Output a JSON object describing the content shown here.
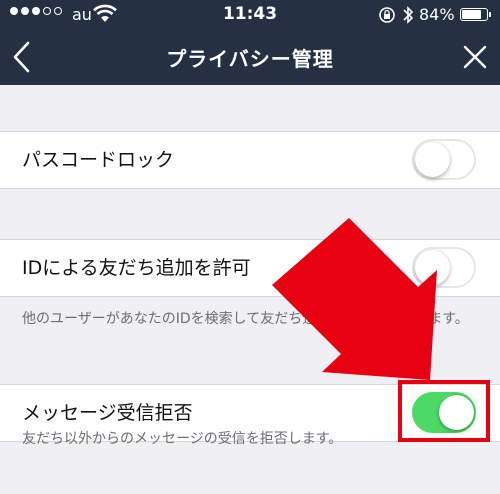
{
  "status_bar": {
    "carrier": "au",
    "time": "11:43",
    "battery": "84%",
    "battery_level": 0.84
  },
  "nav": {
    "title": "プライバシー管理"
  },
  "settings": [
    {
      "label": "パスコードロック",
      "enabled": false
    },
    {
      "label": "IDによる友だち追加を許可",
      "enabled": false
    },
    {
      "label": "メッセージ受信拒否",
      "enabled": true
    }
  ],
  "notes": {
    "id_add": "他のユーザーがあなたのIDを検索して友だち追加することができます。",
    "reject": "友だち以外からのメッセージの受信を拒否します。"
  },
  "colors": {
    "header_bg": "#253043",
    "toggle_on": "#4cd964",
    "annotation": "#e60012"
  }
}
